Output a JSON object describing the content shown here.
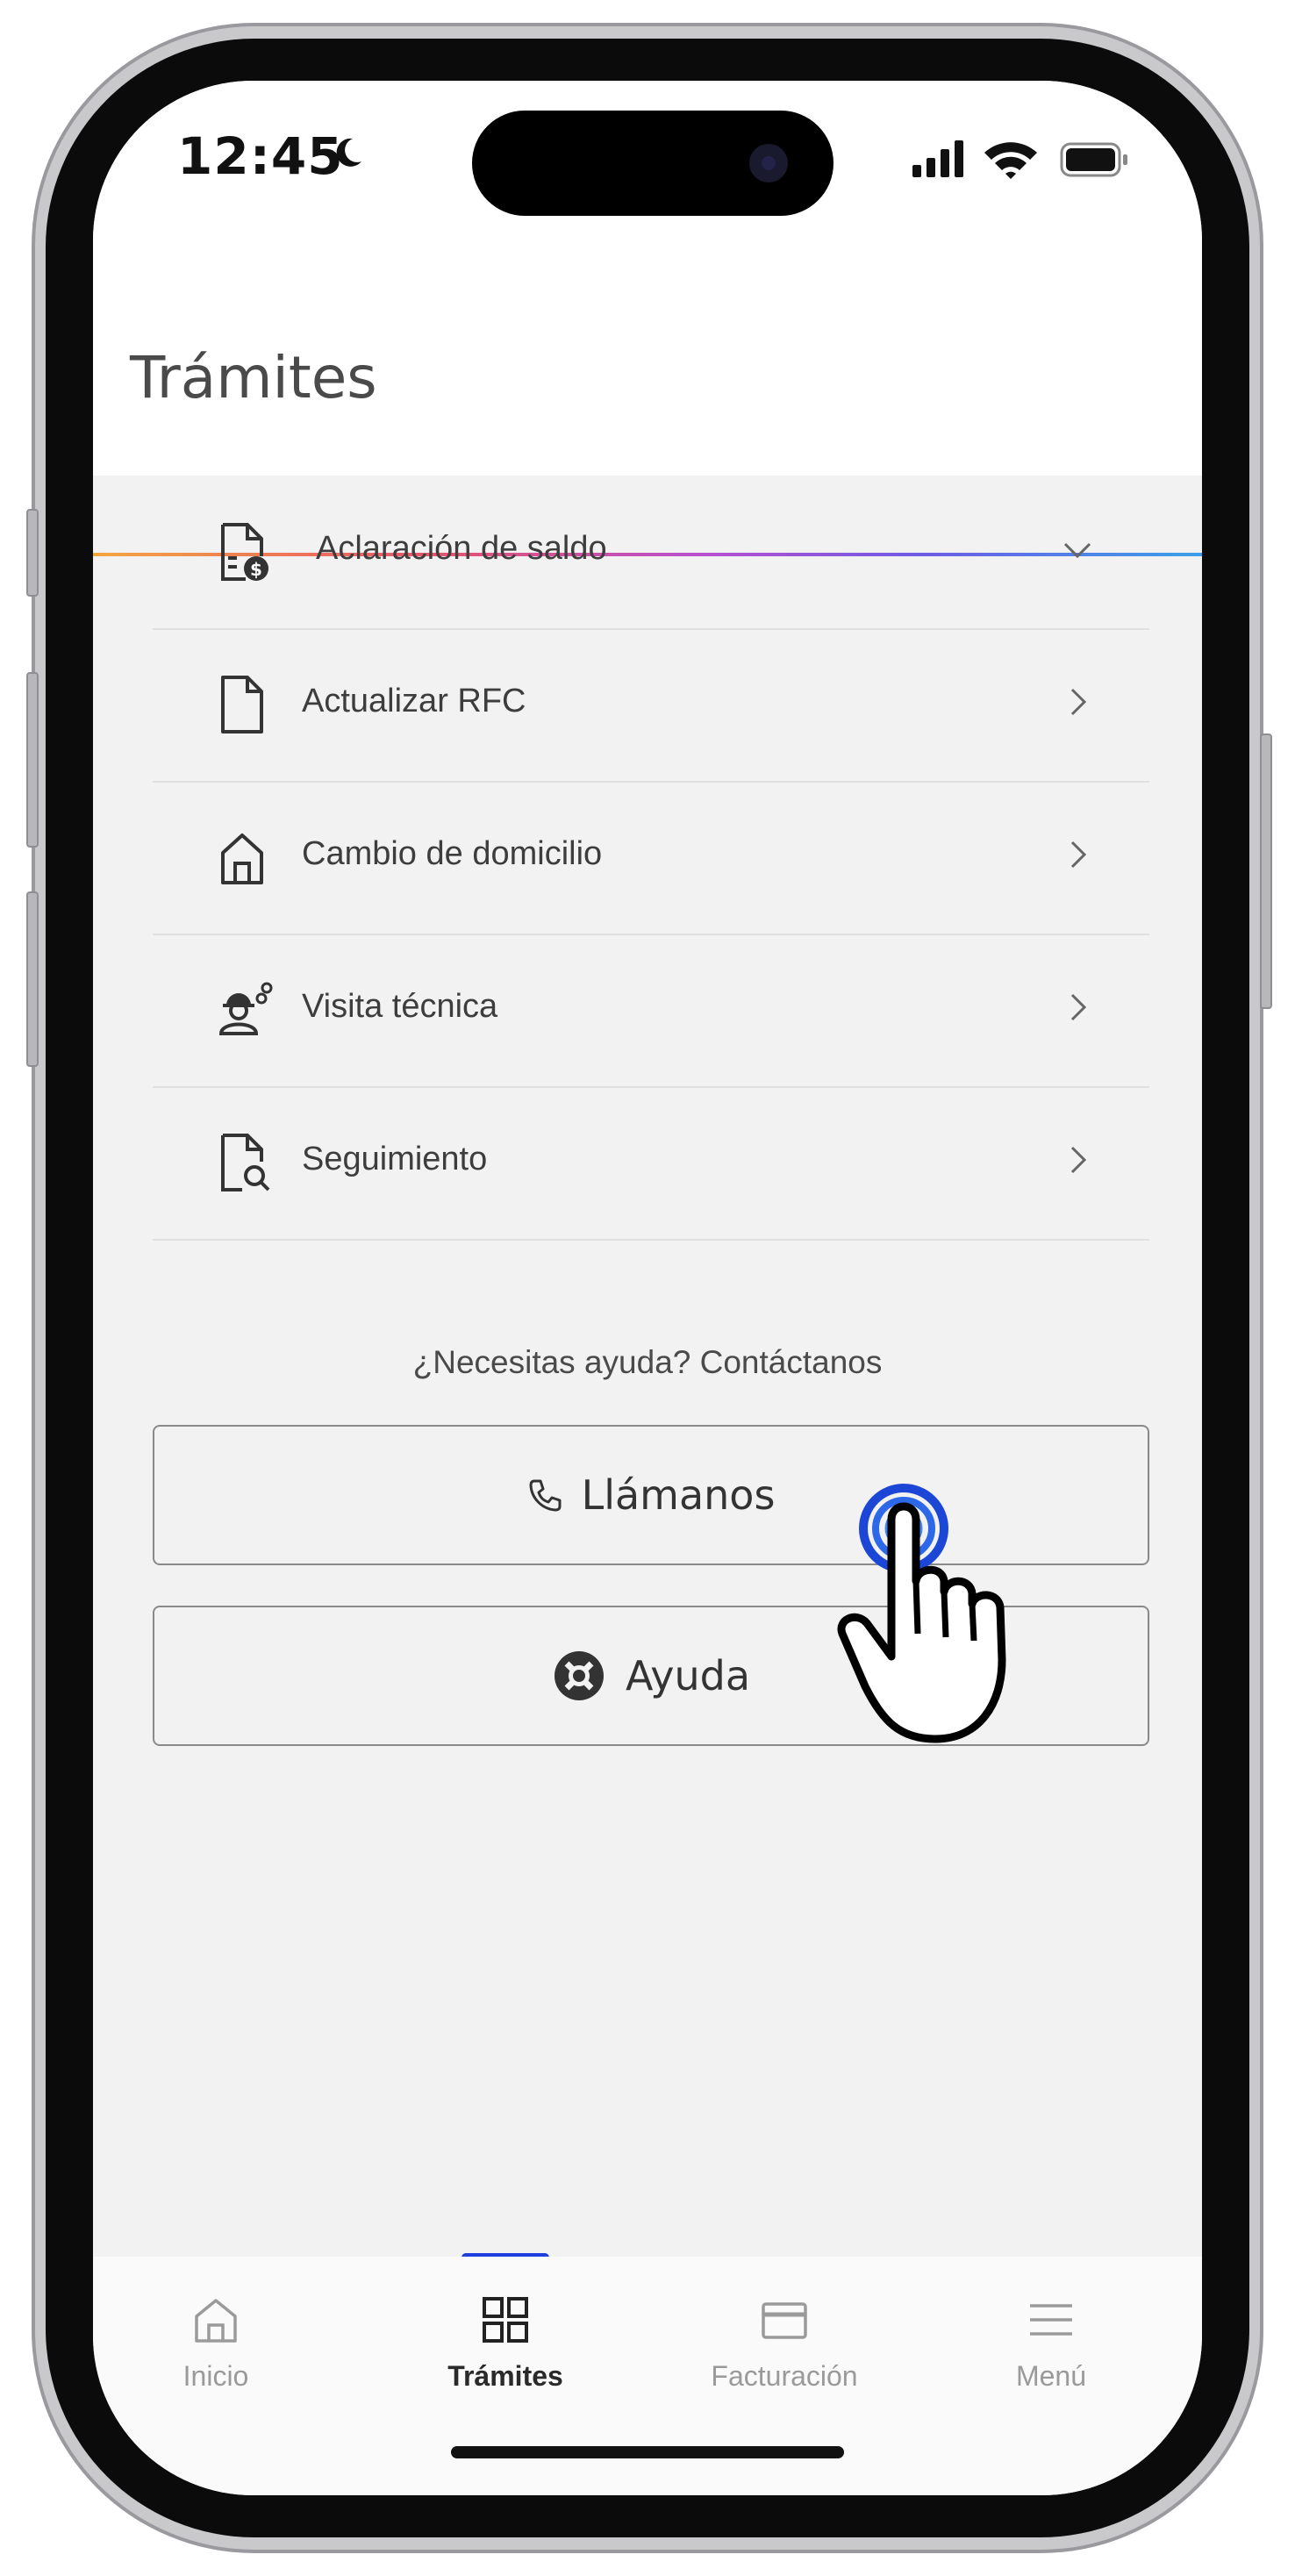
{
  "status_bar": {
    "time": "12:45"
  },
  "header": {
    "title": "Trámites"
  },
  "list": [
    {
      "label": "Aclaración de saldo",
      "icon": "invoice-dollar-icon",
      "chevron": "chevron-down-icon"
    },
    {
      "label": "Actualizar RFC",
      "icon": "document-icon",
      "chevron": "chevron-right-icon"
    },
    {
      "label": "Cambio de domicilio",
      "icon": "home-icon",
      "chevron": "chevron-right-icon"
    },
    {
      "label": "Visita técnica",
      "icon": "technician-icon",
      "chevron": "chevron-right-icon"
    },
    {
      "label": "Seguimiento",
      "icon": "document-search-icon",
      "chevron": "chevron-right-icon"
    }
  ],
  "help": {
    "prompt": "¿Necesitas ayuda? Contáctanos",
    "call_label": "Llámanos",
    "help_label": "Ayuda"
  },
  "nav": {
    "items": [
      {
        "label": "Inicio",
        "icon": "home-icon"
      },
      {
        "label": "Trámites",
        "icon": "grid-icon"
      },
      {
        "label": "Facturación",
        "icon": "card-icon"
      },
      {
        "label": "Menú",
        "icon": "hamburger-icon"
      }
    ],
    "active": "Trámites"
  },
  "colors": {
    "accent": "#1e3ee0",
    "background": "#f2f2f2",
    "text": "#3d3d3d"
  }
}
